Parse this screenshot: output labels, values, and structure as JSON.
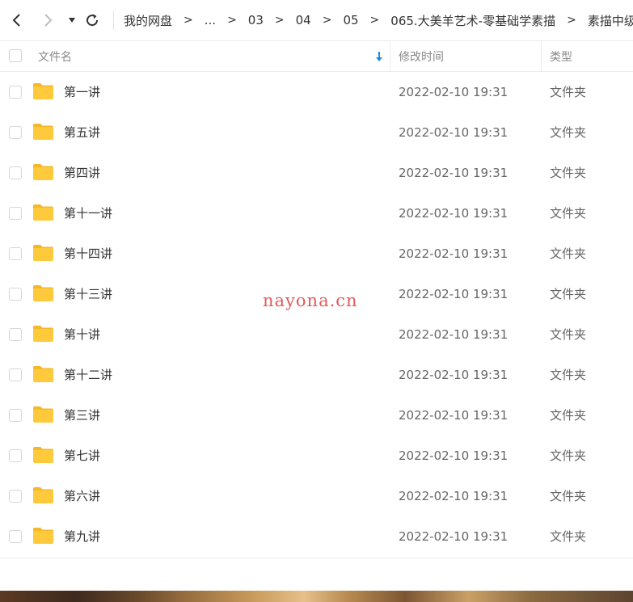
{
  "toolbar": {
    "back_icon": "chevron-left-icon",
    "forward_icon": "chevron-right-icon",
    "history_icon": "caret-down-icon",
    "refresh_icon": "refresh-icon"
  },
  "breadcrumb": {
    "items": [
      "我的网盘",
      "...",
      "03",
      "04",
      "05",
      "065.大美羊艺术-零基础学素描",
      "素描中级"
    ],
    "separator": ">"
  },
  "table": {
    "columns": {
      "name": "文件名",
      "modified": "修改时间",
      "type": "类型"
    },
    "sort_icon": "sort-down-arrow-icon",
    "rows": [
      {
        "name": "第一讲",
        "modified": "2022-02-10 19:31",
        "type": "文件夹"
      },
      {
        "name": "第五讲",
        "modified": "2022-02-10 19:31",
        "type": "文件夹"
      },
      {
        "name": "第四讲",
        "modified": "2022-02-10 19:31",
        "type": "文件夹"
      },
      {
        "name": "第十一讲",
        "modified": "2022-02-10 19:31",
        "type": "文件夹"
      },
      {
        "name": "第十四讲",
        "modified": "2022-02-10 19:31",
        "type": "文件夹"
      },
      {
        "name": "第十三讲",
        "modified": "2022-02-10 19:31",
        "type": "文件夹"
      },
      {
        "name": "第十讲",
        "modified": "2022-02-10 19:31",
        "type": "文件夹"
      },
      {
        "name": "第十二讲",
        "modified": "2022-02-10 19:31",
        "type": "文件夹"
      },
      {
        "name": "第三讲",
        "modified": "2022-02-10 19:31",
        "type": "文件夹"
      },
      {
        "name": "第七讲",
        "modified": "2022-02-10 19:31",
        "type": "文件夹"
      },
      {
        "name": "第六讲",
        "modified": "2022-02-10 19:31",
        "type": "文件夹"
      },
      {
        "name": "第九讲",
        "modified": "2022-02-10 19:31",
        "type": "文件夹"
      }
    ]
  },
  "watermark": "nayona.cn",
  "colors": {
    "folder": "#FFC93C",
    "folder_tab": "#F5B82A",
    "sort_arrow": "#1E88E5",
    "watermark": "#E25A5A"
  }
}
